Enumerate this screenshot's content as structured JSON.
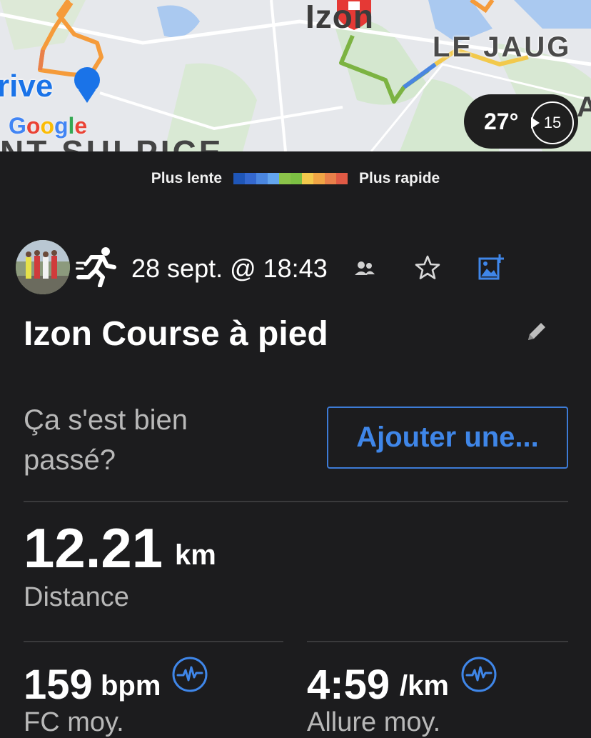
{
  "map": {
    "labels": {
      "izon": "Izon",
      "le_jaug": "LE JAUG",
      "drive": "rive",
      "sulpice": "NT-SULPICE",
      "edge": "A"
    },
    "google": [
      "G",
      "o",
      "o",
      "g",
      "l",
      "e"
    ],
    "google_colors": [
      "#4285f4",
      "#ea4335",
      "#fbbc05",
      "#4285f4",
      "#34a853",
      "#ea4335"
    ],
    "weather": {
      "temperature": "27°",
      "clock_value": "15"
    }
  },
  "legend": {
    "slow_label": "Plus lente",
    "fast_label": "Plus rapide",
    "colors": [
      "#1f56b8",
      "#3468cf",
      "#4a86e0",
      "#63a5ee",
      "#8bc34a",
      "#7cc043",
      "#f2c94c",
      "#f0a545",
      "#e9804a",
      "#e05a45",
      "#d0392e"
    ]
  },
  "activity": {
    "icon": "running-figure-icon",
    "date": "28 sept. @ 18:43",
    "title": "Izon Course à pied",
    "feel_question": "Ça s'est bien passé?",
    "add_button": "Ajouter une..."
  },
  "stats": {
    "distance": {
      "value": "12.21",
      "unit": "km",
      "label": "Distance"
    },
    "heart_rate": {
      "value": "159",
      "unit": "bpm",
      "label": "FC moy.",
      "icon": "heart-rate-icon"
    },
    "pace": {
      "value": "4:59",
      "unit": "/km",
      "label": "Allure moy.",
      "icon": "pace-icon"
    }
  },
  "colors": {
    "accent": "#3f86e8",
    "background": "#1c1c1e",
    "muted_text": "#b8b8b8"
  }
}
